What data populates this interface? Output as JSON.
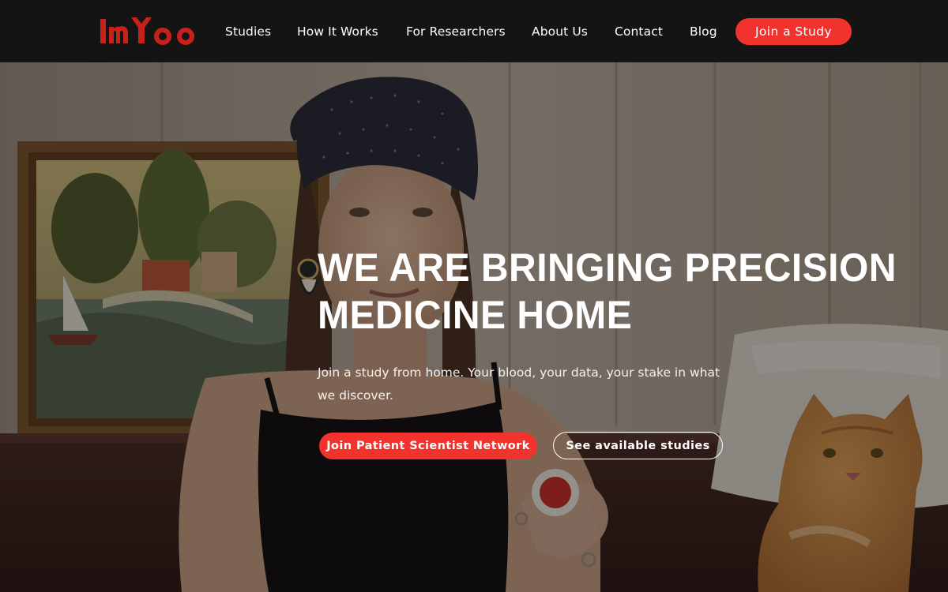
{
  "brand": {
    "logo_text": "ImYoo",
    "logo_color": "#c8201b"
  },
  "nav": {
    "items": [
      {
        "label": "Studies"
      },
      {
        "label": "How It Works"
      },
      {
        "label": "For Researchers"
      },
      {
        "label": "About Us"
      },
      {
        "label": "Contact"
      },
      {
        "label": "Blog"
      }
    ],
    "cta_label": "Join a Study"
  },
  "hero": {
    "title_line1": "WE ARE BRINGING PRECISION",
    "title_line2": "MEDICINE HOME",
    "subtitle_line1": "Join a study from home. Your blood, your data, your stake in what",
    "subtitle_line2": "we discover.",
    "primary_button": "Join Patient Scientist Network",
    "secondary_button": "See available studies",
    "photo_subject": "woman-with-headscarf-holding-blood-collection-device-and-cat"
  },
  "colors": {
    "accent": "#f2322c",
    "nav_background": "#141414",
    "text": "#ffffff"
  }
}
